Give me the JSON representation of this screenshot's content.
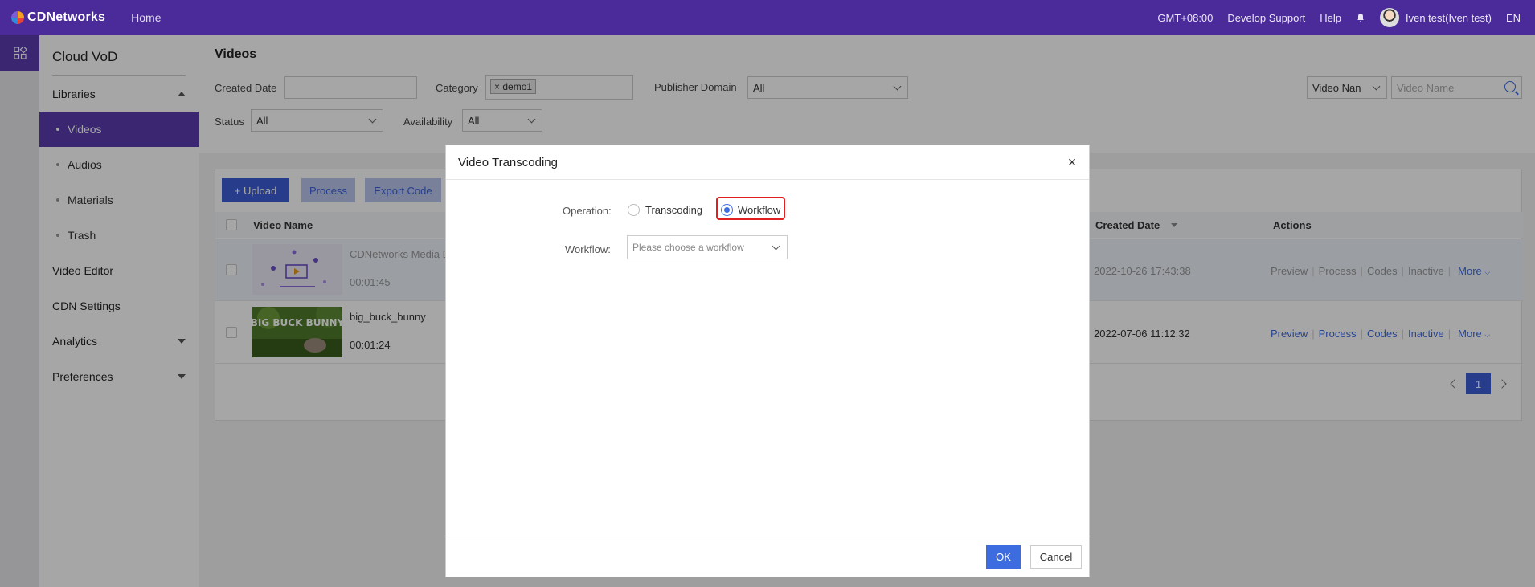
{
  "topbar": {
    "brand": "CDNetworks",
    "home": "Home",
    "timezone": "GMT+08:00",
    "develop_support": "Develop Support",
    "help": "Help",
    "user": "Iven test(Iven test)",
    "language": "EN"
  },
  "sidebar": {
    "title": "Cloud VoD",
    "items": [
      {
        "label": "Libraries"
      },
      {
        "label": "Videos"
      },
      {
        "label": "Audios"
      },
      {
        "label": "Materials"
      },
      {
        "label": "Trash"
      },
      {
        "label": "Video Editor"
      },
      {
        "label": "CDN Settings"
      },
      {
        "label": "Analytics"
      },
      {
        "label": "Preferences"
      }
    ]
  },
  "filters": {
    "page_title": "Videos",
    "created_date_label": "Created Date",
    "created_date_value": "",
    "category_label": "Category",
    "category_tag": "demo1",
    "publisher_label": "Publisher Domain",
    "publisher_value": "All",
    "search_type": "Video Nan",
    "search_placeholder": "Video Name",
    "status_label": "Status",
    "status_value": "All",
    "availability_label": "Availability",
    "availability_value": "All"
  },
  "toolbar": {
    "upload": "+ Upload",
    "process": "Process",
    "export_code": "Export Code"
  },
  "table": {
    "col_name": "Video Name",
    "col_created": "Created Date",
    "col_actions": "Actions",
    "rows": [
      {
        "name": "CDNetworks Media D",
        "duration": "00:01:45",
        "created": "2022-10-26 17:43:38"
      },
      {
        "name": "big_buck_bunny",
        "duration": "00:01:24",
        "created": "2022-07-06 11:12:32"
      }
    ],
    "actions": {
      "preview": "Preview",
      "process": "Process",
      "codes": "Codes",
      "inactive": "Inactive",
      "more": "More"
    },
    "thumb_text": "BIG BUCK BUNNY",
    "page": "1"
  },
  "modal": {
    "title": "Video Transcoding",
    "close": "×",
    "operation_label": "Operation:",
    "option_transcoding": "Transcoding",
    "option_workflow": "Workflow",
    "workflow_label": "Workflow:",
    "workflow_placeholder": "Please choose a workflow",
    "ok": "OK",
    "cancel": "Cancel"
  },
  "colors": {
    "topbar": "#4b2a9a",
    "sidebar_active": "#5b3bb0",
    "primary": "#3d6be0",
    "highlight": "#e02020"
  }
}
